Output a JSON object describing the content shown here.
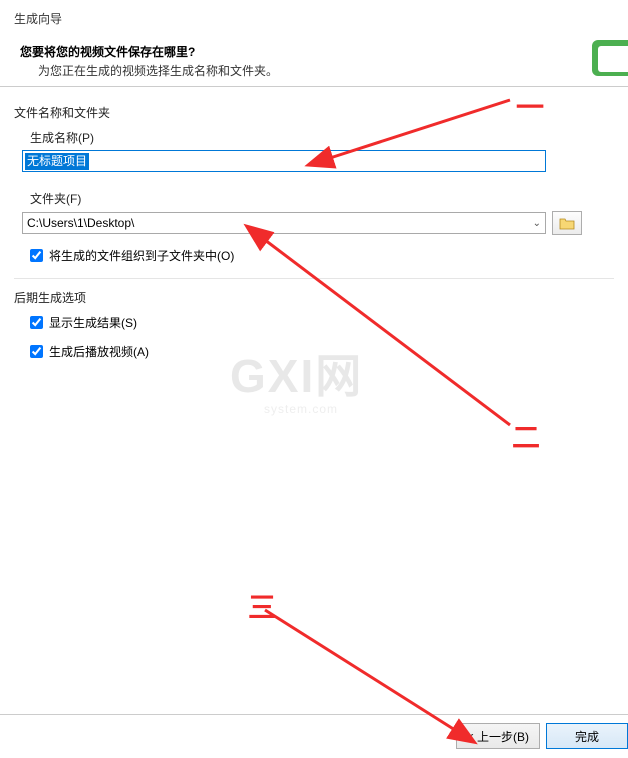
{
  "header": {
    "wizard_title": "生成向导",
    "question": "您要将您的视频文件保存在哪里?",
    "subtext": "为您正在生成的视频选择生成名称和文件夹。"
  },
  "filename_section": {
    "group_label": "文件名称和文件夹",
    "name_label": "生成名称(P)",
    "name_value": "无标题项目",
    "folder_label": "文件夹(F)",
    "folder_value": "C:\\Users\\1\\Desktop\\",
    "organize_checkbox_label": "将生成的文件组织到子文件夹中(O)",
    "organize_checked": true
  },
  "post_section": {
    "group_label": "后期生成选项",
    "show_results_label": "显示生成结果(S)",
    "show_results_checked": true,
    "play_after_label": "生成后播放视频(A)",
    "play_after_checked": true
  },
  "buttons": {
    "back": "< 上一步(B)",
    "finish": "完成"
  },
  "annotations": {
    "mark1": "一",
    "mark2": "二",
    "mark3": "三"
  },
  "watermark": {
    "main": "GXI网",
    "sub": "system.com"
  }
}
